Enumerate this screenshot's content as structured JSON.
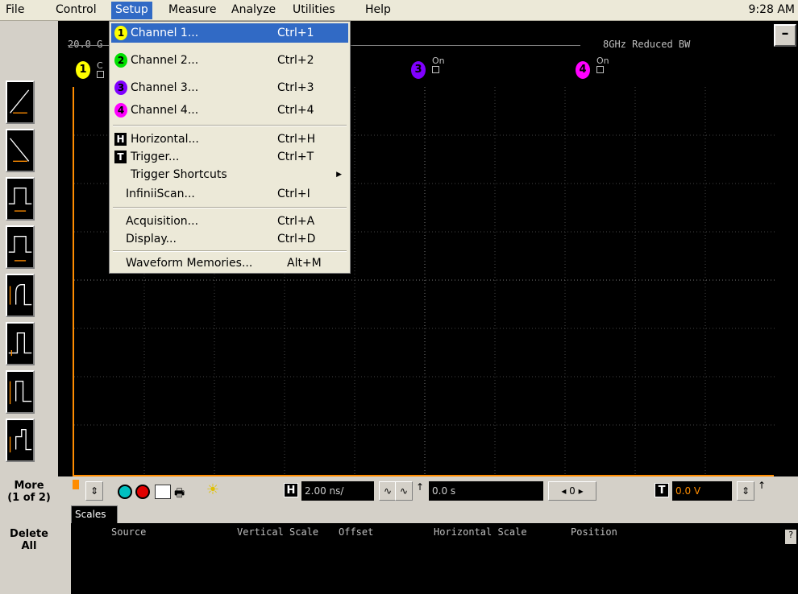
{
  "menubar": {
    "items": [
      "File",
      "Control",
      "Setup",
      "Measure",
      "Analyze",
      "Utilities",
      "Help"
    ],
    "clock": "9:28 AM"
  },
  "status": {
    "sample_rate": "20.0 G",
    "bandwidth": "8GHz Reduced BW",
    "minimize_label": "–"
  },
  "channels": [
    {
      "num": "1",
      "state": "C",
      "color": "#ffff00"
    },
    {
      "num": "3",
      "state": "On",
      "color": "#8000ff"
    },
    {
      "num": "4",
      "state": "On",
      "color": "#ff00ff"
    }
  ],
  "setup_menu": {
    "items": [
      {
        "icon": "1",
        "icon_color": "#ffff00",
        "label": "Channel 1...",
        "shortcut": "Ctrl+1"
      },
      {
        "icon": "2",
        "icon_color": "#00e000",
        "label": "Channel 2...",
        "shortcut": "Ctrl+2"
      },
      {
        "icon": "3",
        "icon_color": "#8000ff",
        "label": "Channel 3...",
        "shortcut": "Ctrl+3"
      },
      {
        "icon": "4",
        "icon_color": "#ff00ff",
        "label": "Channel 4...",
        "shortcut": "Ctrl+4"
      },
      {
        "icon": "H",
        "label": "Horizontal...",
        "shortcut": "Ctrl+H"
      },
      {
        "icon": "T",
        "label": "Trigger...",
        "shortcut": "Ctrl+T"
      },
      {
        "label": "Trigger Shortcuts",
        "shortcut": ""
      },
      {
        "label": "InfiniiScan...",
        "shortcut": "Ctrl+I"
      },
      {
        "label": "Acquisition...",
        "shortcut": "Ctrl+A"
      },
      {
        "label": "Display...",
        "shortcut": "Ctrl+D"
      },
      {
        "label": "Waveform Memories...",
        "shortcut": "Alt+M"
      }
    ]
  },
  "side": {
    "more_label": "More",
    "more_page": "(1 of 2)",
    "delete_label": "Delete",
    "delete_all": "All"
  },
  "bottombar": {
    "timebase": "2.00 ns/",
    "delay": "0.0 s",
    "trigger_level": "0.0 V",
    "delay_ref": "0",
    "h_icon": "H",
    "t_icon": "T"
  },
  "scales": {
    "tab": "Scales",
    "columns": [
      "Source",
      "Vertical Scale",
      "Offset",
      "Horizontal Scale",
      "Position"
    ],
    "help": "?"
  },
  "colors": {
    "ch1": "#ffff00",
    "ch2": "#00e000",
    "ch3": "#8000ff",
    "ch4": "#ff00ff",
    "trigger": "#ff8c00",
    "highlight": "#316ac5"
  }
}
